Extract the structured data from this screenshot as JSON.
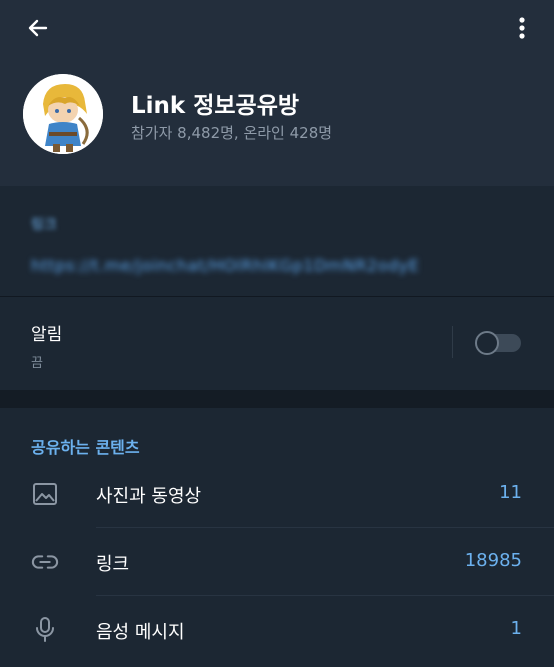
{
  "header": {
    "title": "Link 정보공유방",
    "subtitle": "참가자 8,482명, 온라인 428명",
    "back_icon": "arrow-left-icon",
    "more_icon": "more-vertical-icon"
  },
  "info": {
    "label": "링크",
    "link": "https://t.me/joinchat/HOlRhIKGp1DmNR2odyE"
  },
  "notifications": {
    "title": "알림",
    "status": "끔",
    "enabled": false
  },
  "shared_media": {
    "header": "공유하는 콘텐츠",
    "items": [
      {
        "label": "사진과 동영상",
        "count": "11",
        "icon": "image-icon"
      },
      {
        "label": "링크",
        "count": "18985",
        "icon": "link-icon"
      },
      {
        "label": "음성 메시지",
        "count": "1",
        "icon": "microphone-icon"
      }
    ]
  },
  "colors": {
    "header_bg": "#232e3c",
    "section_bg": "#1c2733",
    "accent": "#6cb1ee",
    "secondary_text": "#8e9aa8"
  }
}
